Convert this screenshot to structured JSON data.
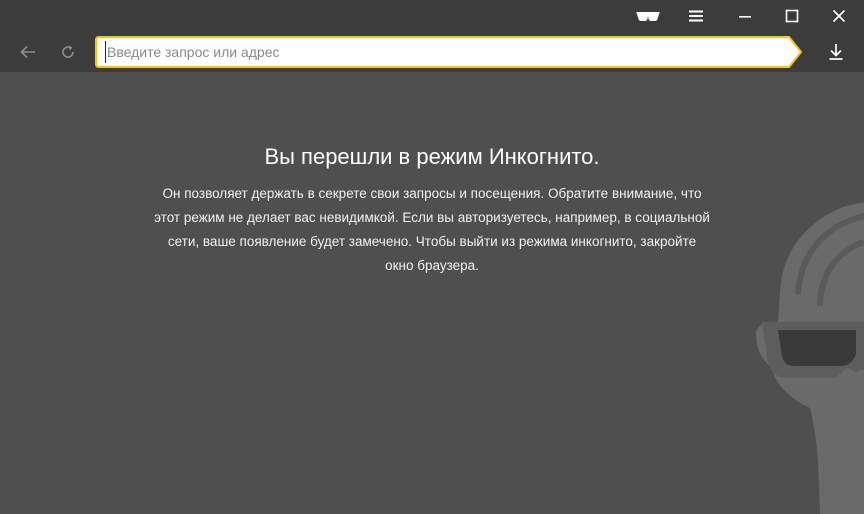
{
  "titlebar": {
    "icons": [
      "incognito-glasses-icon",
      "menu-icon",
      "minimize-icon",
      "maximize-icon",
      "close-icon"
    ]
  },
  "toolbar": {
    "back_icon": "arrow-left-icon",
    "reload_icon": "reload-icon",
    "download_icon": "download-icon",
    "omnibox": {
      "placeholder": "Введите запрос или адрес",
      "value": ""
    }
  },
  "incognito": {
    "title": "Вы перешли в режим Инкогнито.",
    "lines": [
      "Он позволяет держать в секрете свои запросы и посещения. Обратите внимание, что",
      "этот режим не делает вас невидимкой. Если вы авторизуетесь, например, в социальной",
      "сети, ваше появление будет замечено. Чтобы выйти из режима инкогнито, закройте",
      "окно браузера."
    ]
  },
  "colors": {
    "accent": "#f5c518",
    "background": "#4f4f4f",
    "chrome": "#3c3c3c"
  }
}
